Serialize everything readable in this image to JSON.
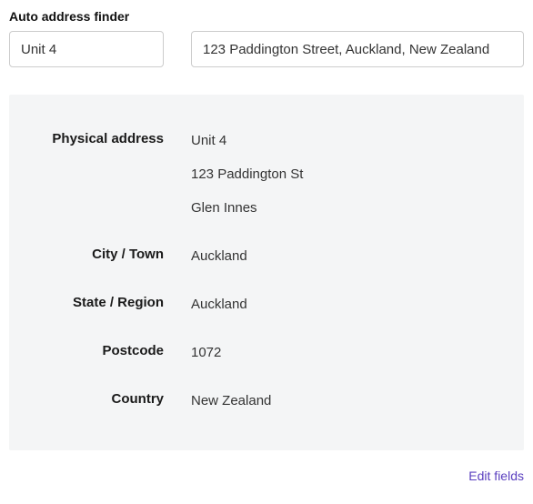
{
  "form": {
    "label": "Auto address finder",
    "unit_value": "Unit 4",
    "address_value": "123 Paddington Street, Auckland, New Zealand"
  },
  "details": {
    "physical_address": {
      "label": "Physical address",
      "line1": "Unit 4",
      "line2": "123 Paddington St",
      "line3": "Glen Innes"
    },
    "city": {
      "label": "City / Town",
      "value": "Auckland"
    },
    "state": {
      "label": "State / Region",
      "value": "Auckland"
    },
    "postcode": {
      "label": "Postcode",
      "value": "1072"
    },
    "country": {
      "label": "Country",
      "value": "New Zealand"
    }
  },
  "actions": {
    "edit_fields": "Edit fields"
  }
}
